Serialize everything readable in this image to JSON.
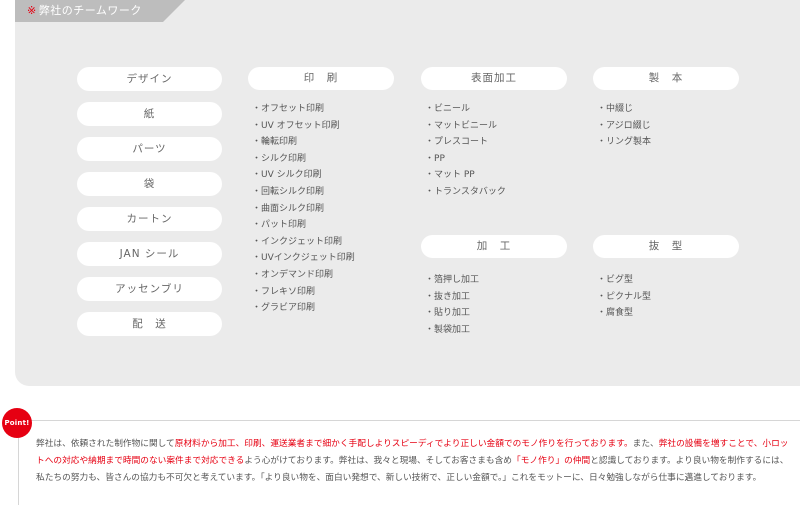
{
  "title": {
    "mark": "※",
    "text": "弊社のチームワーク"
  },
  "left_buttons": [
    "デザイン",
    "紙",
    "パーツ",
    "袋",
    "カートン",
    "JAN シール",
    "アッセンブリ",
    "配　送"
  ],
  "sections": {
    "printing": {
      "heading": "印　刷",
      "items": [
        "オフセット印刷",
        "UV オフセット印刷",
        "輪転印刷",
        "シルク印刷",
        "UV シルク印刷",
        "回転シルク印刷",
        "曲面シルク印刷",
        "パット印刷",
        "インクジェット印刷",
        "UVインクジェット印刷",
        "オンデマンド印刷",
        "フレキソ印刷",
        "グラビア印刷"
      ]
    },
    "surface": {
      "heading": "表面加工",
      "items": [
        "ビニール",
        "マットビニール",
        "プレスコート",
        "PP",
        "マット PP",
        "トランスタバック"
      ]
    },
    "binding": {
      "heading": "製　本",
      "items": [
        "中綴じ",
        "アジロ綴じ",
        "リング製本"
      ]
    },
    "processing": {
      "heading": "加　工",
      "items": [
        "箔押し加工",
        "抜き加工",
        "貼り加工",
        "製袋加工"
      ]
    },
    "die": {
      "heading": "抜　型",
      "items": [
        "ビグ型",
        "ピクナル型",
        "腐食型"
      ]
    }
  },
  "point": {
    "badge": "Point!",
    "segments": [
      {
        "t": "弊社は、依頼された制作物に関して",
        "h": false
      },
      {
        "t": "原材料から加工、印刷、運送業者まで細かく手配しよりスピーディでより正しい金額でのモノ作りを行っております。",
        "h": true
      },
      {
        "t": "また、",
        "h": false
      },
      {
        "t": "弊社の設備を増すことで、小ロットへの対応や納期まで時間のない案件まで対応できる",
        "h": true
      },
      {
        "t": "よう心がけております。弊社は、我々と現場、そしてお客さまも含め",
        "h": false
      },
      {
        "t": "「モノ作り」の仲間",
        "h": true
      },
      {
        "t": "と認識しております。より良い物を制作するには、私たちの努力も、皆さんの協力も不可欠と考えています。「より良い物を、面白い発想で、新しい技術で、正しい金額で。」これをモットーに、日々勉強しながら仕事に邁進しております。",
        "h": false
      }
    ]
  }
}
